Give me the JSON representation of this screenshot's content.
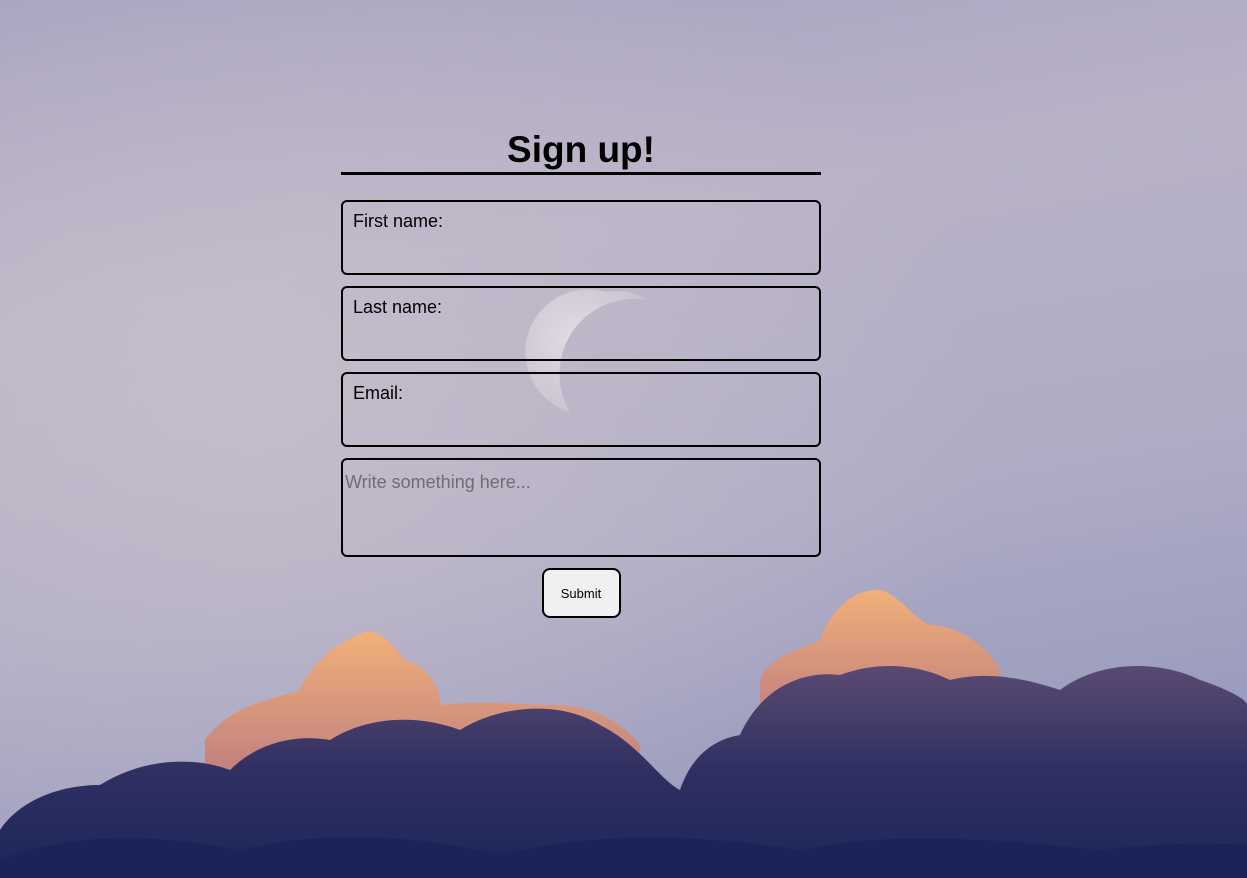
{
  "form": {
    "title": "Sign up!",
    "fields": [
      {
        "label": "First name:",
        "value": ""
      },
      {
        "label": "Last name:",
        "value": ""
      },
      {
        "label": "Email:",
        "value": ""
      }
    ],
    "message": {
      "placeholder": "Write something here...",
      "value": ""
    },
    "submit_label": "Submit"
  },
  "colors": {
    "sky_top": "#a7a2c0",
    "sky_mid": "#bdb6c8",
    "cloud_dark": "#1f2a5c",
    "cloud_highlight": "#f0a870",
    "border": "#000000",
    "button_bg": "#f0f0f0"
  },
  "background": {
    "scene": "evening-sky-with-moon-and-clouds"
  }
}
